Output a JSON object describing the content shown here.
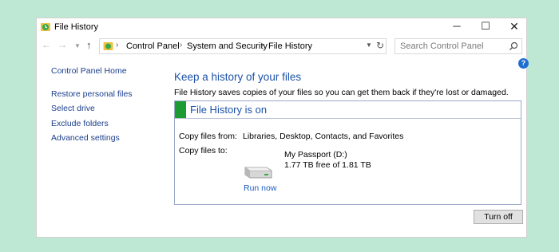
{
  "window": {
    "title": "File History",
    "minimize_glyph": "─",
    "maximize_glyph": "☐",
    "close_glyph": "✕",
    "icon": "file-history-icon"
  },
  "addressbar": {
    "crumbs": [
      "Control Panel",
      "System and Security",
      "File History"
    ],
    "search_placeholder": "Search Control Panel"
  },
  "sidebar": {
    "home": "Control Panel Home",
    "links": [
      "Restore personal files",
      "Select drive",
      "Exclude folders",
      "Advanced settings"
    ]
  },
  "main": {
    "heading": "Keep a history of your files",
    "description": "File History saves copies of your files so you can get them back if they're lost or damaged.",
    "status": "File History is on",
    "copy_from_label": "Copy files from:",
    "copy_from_value": "Libraries, Desktop, Contacts, and Favorites",
    "copy_to_label": "Copy files to:",
    "drive_name": "My Passport (D:)",
    "drive_space": "1.77 TB free of 1.81 TB",
    "run_now": "Run now",
    "turn_off": "Turn off"
  },
  "colors": {
    "background": "#bfe8d4",
    "link": "#1b3e8c",
    "heading": "#1c52a8",
    "status_green": "#1c9a33"
  }
}
